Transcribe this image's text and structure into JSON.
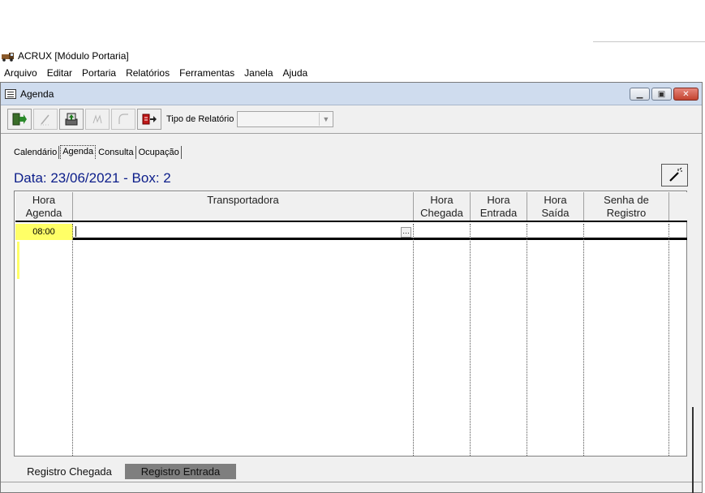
{
  "app": {
    "title": "ACRUX [Módulo Portaria]",
    "icon": "truck-icon"
  },
  "menu": {
    "items": [
      "Arquivo",
      "Editar",
      "Portaria",
      "Relatórios",
      "Ferramentas",
      "Janela",
      "Ajuda"
    ]
  },
  "window": {
    "title": "Agenda",
    "icon": "form-icon",
    "controls": {
      "minimize": "minimize-icon",
      "maximize": "restore-icon",
      "close": "close-icon"
    }
  },
  "toolbar": {
    "buttons": [
      {
        "name": "exit-icon",
        "enabled": true
      },
      {
        "name": "edit-icon",
        "enabled": false
      },
      {
        "name": "save-icon",
        "enabled": true
      },
      {
        "name": "signature-icon",
        "enabled": false
      },
      {
        "name": "cancel-icon",
        "enabled": false
      },
      {
        "name": "export-icon",
        "enabled": true
      }
    ],
    "report_type_label": "Tipo de Relatório",
    "report_type_value": ""
  },
  "tabs": [
    "Calendário",
    "Agenda",
    "Consulta",
    "Ocupação"
  ],
  "active_tab": "Agenda",
  "header": {
    "date_title": "Data: 23/06/2021 - Box: 2"
  },
  "grid": {
    "columns": [
      {
        "label_1": "Hora",
        "label_2": "Agenda"
      },
      {
        "label_1": "Transportadora",
        "label_2": ""
      },
      {
        "label_1": "Hora",
        "label_2": "Chegada"
      },
      {
        "label_1": "Hora",
        "label_2": "Entrada"
      },
      {
        "label_1": "Hora",
        "label_2": "Saída"
      },
      {
        "label_1": "Senha de",
        "label_2": "Registro"
      }
    ],
    "rows": [
      {
        "hora_agenda": "08:00",
        "transportadora": "",
        "hora_chegada": "",
        "hora_entrada": "",
        "hora_saida": "",
        "senha": ""
      }
    ],
    "highlight_color": "#ffff66"
  },
  "buttons": {
    "registro_chegada": "Registro Chegada",
    "registro_entrada": "Registro Entrada"
  }
}
